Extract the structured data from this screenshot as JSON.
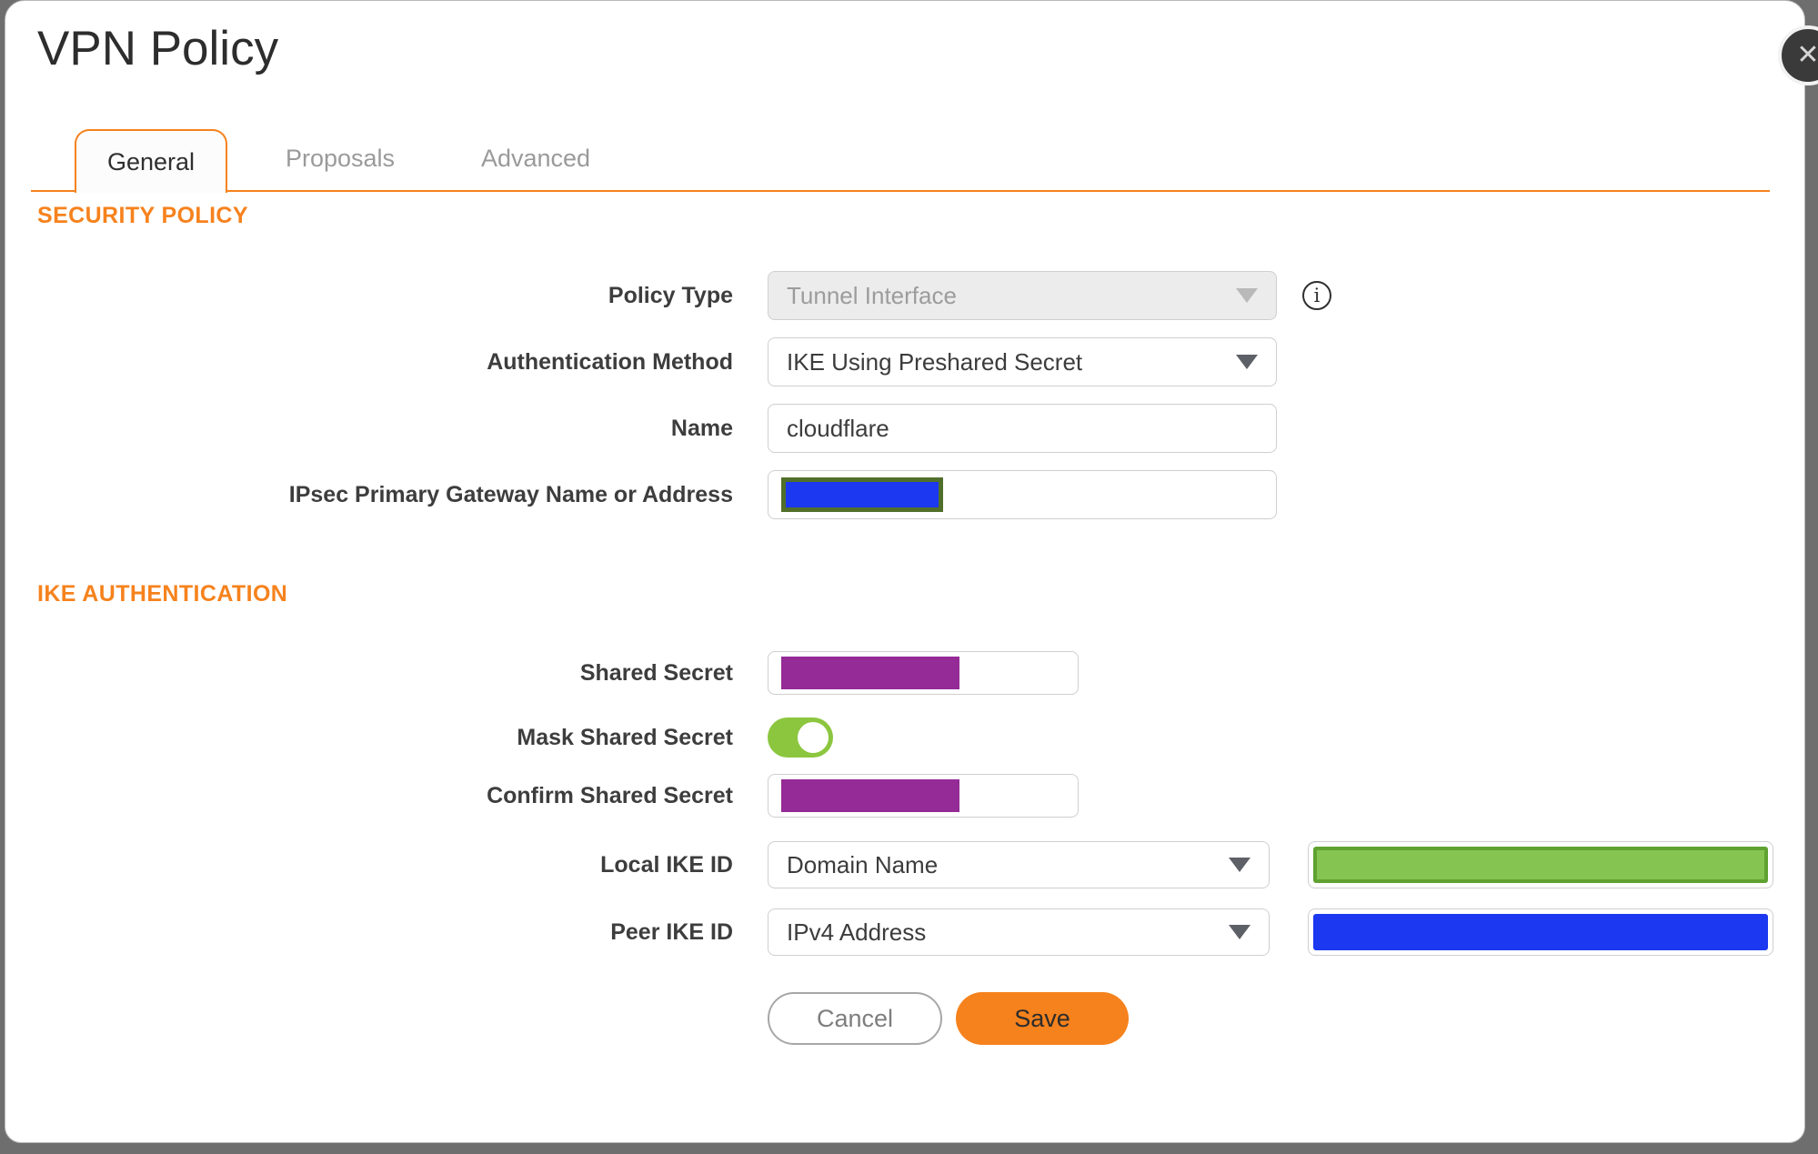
{
  "title": "VPN Policy",
  "tabs": [
    {
      "label": "General",
      "active": true
    },
    {
      "label": "Proposals",
      "active": false
    },
    {
      "label": "Advanced",
      "active": false
    }
  ],
  "sections": {
    "security_policy": "SECURITY POLICY",
    "ike_authentication": "IKE AUTHENTICATION"
  },
  "form": {
    "policy_type": {
      "label": "Policy Type",
      "value": "Tunnel Interface",
      "disabled": true
    },
    "authentication_method": {
      "label": "Authentication Method",
      "value": "IKE Using Preshared Secret"
    },
    "name": {
      "label": "Name",
      "value": "cloudflare"
    },
    "ipsec_primary_gateway": {
      "label": "IPsec Primary Gateway Name or Address",
      "value_state": "redacted-blue"
    },
    "shared_secret": {
      "label": "Shared Secret",
      "value_state": "redacted-purple"
    },
    "mask_shared_secret": {
      "label": "Mask Shared Secret",
      "state": "on"
    },
    "confirm_shared_secret": {
      "label": "Confirm Shared Secret",
      "value_state": "redacted-purple"
    },
    "local_ike_id": {
      "label": "Local IKE ID",
      "type": "Domain Name",
      "value_state": "redacted-green"
    },
    "peer_ike_id": {
      "label": "Peer IKE ID",
      "type": "IPv4 Address",
      "value_state": "redacted-blue"
    }
  },
  "buttons": {
    "cancel": "Cancel",
    "save": "Save"
  },
  "icons": {
    "info": "i",
    "close": "✕"
  },
  "colors": {
    "accent": "#f6821d",
    "overlay": "#6e6e6e",
    "toggle_green": "#8cc63f",
    "redaction_purple": "#942b96",
    "redaction_blue": "#1c38f0",
    "gateway_border": "#516f2a",
    "ike_green_fill": "#85c450",
    "ike_green_border": "#5fa231"
  }
}
